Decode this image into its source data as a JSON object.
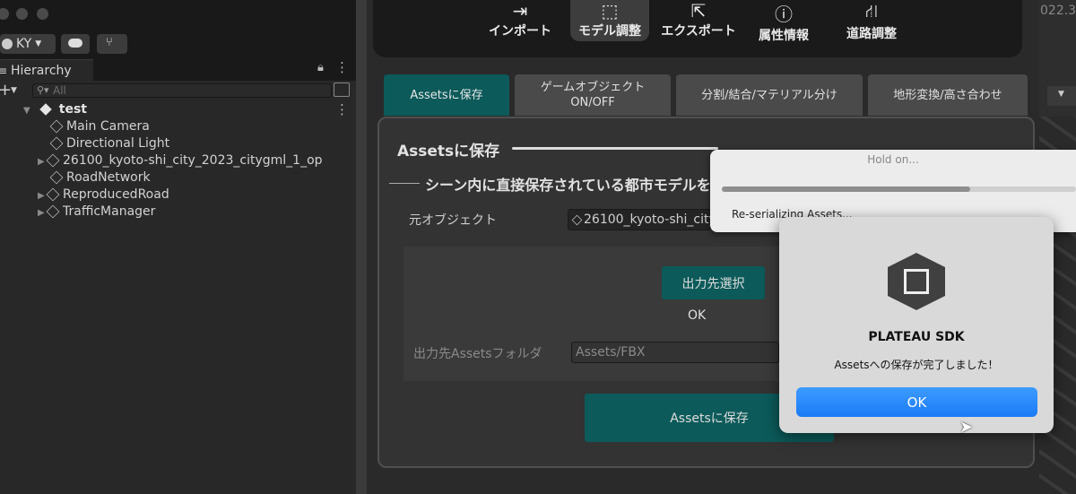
{
  "account": {
    "initials": "KY"
  },
  "hierarchy": {
    "tab_label": "Hierarchy",
    "search_placeholder": "All",
    "scene_name": "test",
    "items": [
      {
        "label": "Main Camera"
      },
      {
        "label": "Directional Light"
      },
      {
        "label": "26100_kyoto-shi_city_2023_citygml_1_op"
      },
      {
        "label": "RoadNetwork"
      },
      {
        "label": "ReproducedRoad"
      },
      {
        "label": "TrafficManager"
      }
    ]
  },
  "toolbar": {
    "items": [
      {
        "label": "インポート",
        "icon": "import-icon"
      },
      {
        "label": "モデル調整",
        "icon": "cursor-icon",
        "active": true
      },
      {
        "label": "エクスポート",
        "icon": "export-icon"
      },
      {
        "label": "属性情報",
        "icon": "info-icon"
      },
      {
        "label": "道路調整",
        "icon": "road-icon"
      }
    ],
    "version_fragment": "022.3"
  },
  "subtabs": {
    "save": "Assetsに保存",
    "gameobject": "ゲームオブジェクト\nON/OFF",
    "split": "分割/結合/マテリアル分け",
    "terrain": "地形変換/高さ合わせ"
  },
  "panel": {
    "title": "Assetsに保存",
    "section": "シーン内に直接保存されている都市モデルを",
    "source_label": "元オブジェクト",
    "source_value": "26100_kyoto-shi_city",
    "select_dest_button": "出力先選択",
    "ok_text": "OK",
    "dest_label": "出力先Assetsフォルダ",
    "dest_value": "Assets/FBX",
    "save_button": "Assetsに保存"
  },
  "hold_dialog": {
    "title": "Hold on...",
    "message": "Re-serializing Assets...",
    "progress": 0.7
  },
  "alert": {
    "title": "PLATEAU SDK",
    "message": "Assetsへの保存が完了しました！",
    "ok_button": "OK"
  },
  "colors": {
    "teal": "#0c5a5a",
    "ok_blue": "#1a7bf5"
  }
}
